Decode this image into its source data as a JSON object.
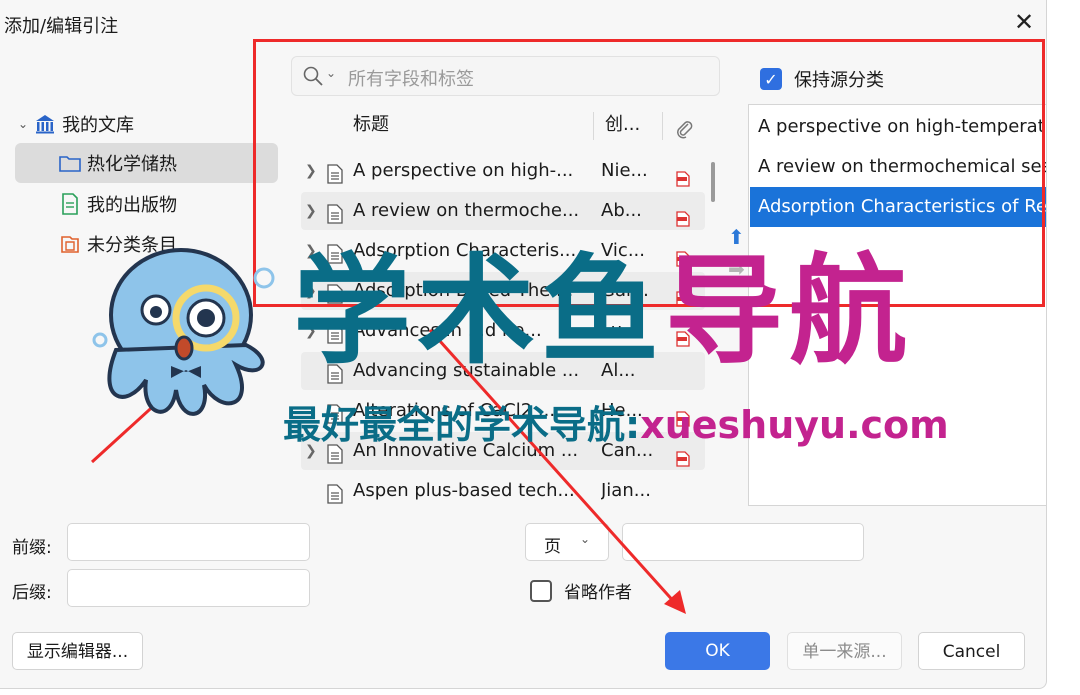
{
  "dialog": {
    "title": "添加/编辑引注",
    "close_glyph": "✕"
  },
  "library_tree": {
    "root": {
      "label": "我的文库",
      "icon": "library-icon"
    },
    "items": [
      {
        "label": "热化学储热",
        "icon": "folder-icon",
        "selected": true
      },
      {
        "label": "我的出版物",
        "icon": "document-icon",
        "selected": false
      },
      {
        "label": "未分类条目",
        "icon": "unfiled-icon",
        "selected": false
      }
    ]
  },
  "search": {
    "placeholder": "所有字段和标签"
  },
  "table": {
    "headers": {
      "title": "标题",
      "creator": "创...",
      "attachment_icon": "paperclip-icon"
    },
    "rows": [
      {
        "title": "A perspective on high-...",
        "creator": "Nie...",
        "expandable": true,
        "has_pdf": true
      },
      {
        "title": "A review on thermoche...",
        "creator": "Ab...",
        "expandable": true,
        "has_pdf": true
      },
      {
        "title": "Adsorption Characteris...",
        "creator": "Vic...",
        "expandable": true,
        "has_pdf": true
      },
      {
        "title": "Adsorption Based Ther...",
        "creator": "Gar...",
        "expandable": true,
        "has_pdf": true
      },
      {
        "title": "Advances in ...d he...",
        "creator": "Lu...",
        "expandable": true,
        "has_pdf": true
      },
      {
        "title": "Advancing sustainable ...",
        "creator": "Al...",
        "expandable": false,
        "has_pdf": false
      },
      {
        "title": "Alterations of CaCl2 ...",
        "creator": "He...",
        "expandable": false,
        "has_pdf": true
      },
      {
        "title": "An Innovative Calcium ...",
        "creator": "Can...",
        "expandable": true,
        "has_pdf": true
      },
      {
        "title": "Aspen plus-based tech...",
        "creator": "Jian...",
        "expandable": false,
        "has_pdf": false
      }
    ]
  },
  "keep_sources": {
    "label": "保持源分类",
    "checked": true
  },
  "selected_citations": [
    {
      "title": "A perspective on high-temperatu",
      "selected": false
    },
    {
      "title": "A review on thermochemical sea",
      "selected": false
    },
    {
      "title": "Adsorption Characteristics of Ref",
      "selected": true
    }
  ],
  "form": {
    "prefix_label": "前缀:",
    "suffix_label": "后缀:",
    "locator_select": "页",
    "omit_author_label": "省略作者",
    "omit_author_checked": false
  },
  "buttons": {
    "show_editor": "显示编辑器...",
    "ok": "OK",
    "single_source": "单一来源...",
    "cancel": "Cancel"
  },
  "watermark": {
    "main_part1": "学术鱼",
    "main_part2": "导航",
    "sub_part1": "最好最全的学术导航:",
    "sub_part2": "xueshuyu.com"
  },
  "colors": {
    "accent": "#3b78e7",
    "selection": "#1a73d9",
    "annotation_red": "#ee2a2a",
    "watermark_blue": "#0a6d87",
    "watermark_pink": "#c3238f"
  }
}
